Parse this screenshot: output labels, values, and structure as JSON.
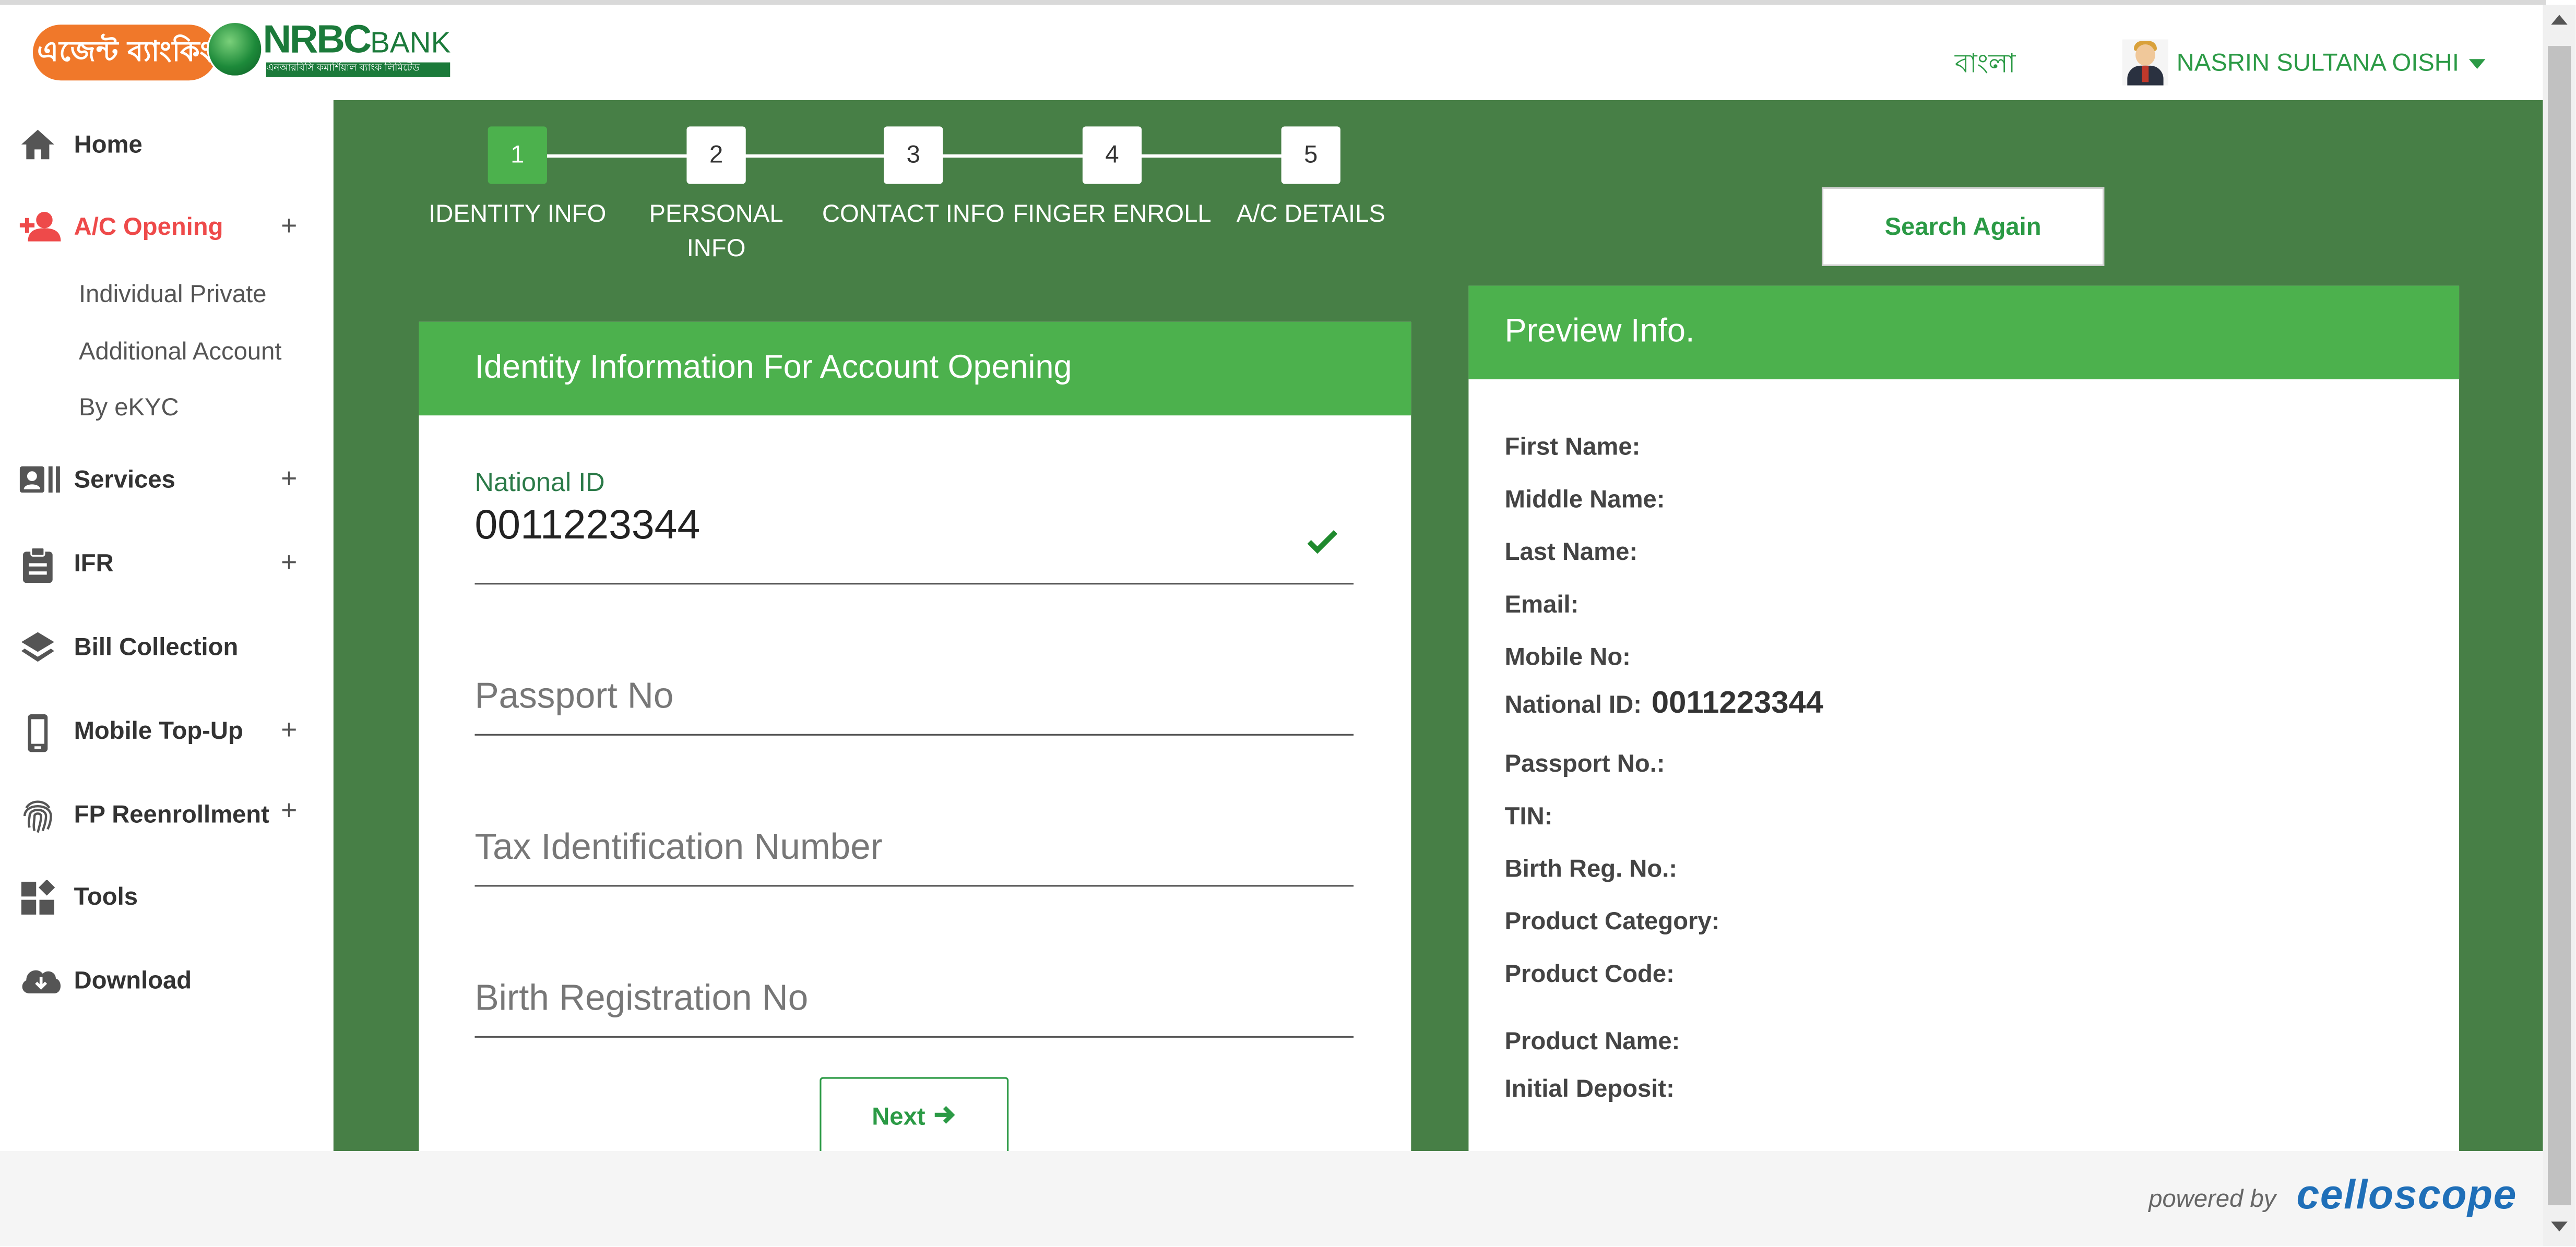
{
  "header": {
    "logo_agent_text": "এজেন্ট ব্যাংকিং",
    "logo_brand": "NRBC",
    "logo_bank": "BANK",
    "logo_tagline": "এনআরবিসি কমার্শিয়াল ব্যাংক লিমিটেড",
    "language": "বাংলা",
    "user_name": "NASRIN SULTANA OISHI"
  },
  "sidebar": {
    "items": [
      {
        "label": "Home",
        "icon": "home-icon",
        "expandable": false
      },
      {
        "label": "A/C Opening",
        "icon": "user-plus-icon",
        "expandable": true,
        "active": true,
        "children": [
          "Individual Private",
          "Additional Account",
          "By eKYC"
        ]
      },
      {
        "label": "Services",
        "icon": "id-card-icon",
        "expandable": true
      },
      {
        "label": "IFR",
        "icon": "clipboard-icon",
        "expandable": true
      },
      {
        "label": "Bill Collection",
        "icon": "layers-icon",
        "expandable": false
      },
      {
        "label": "Mobile Top-Up",
        "icon": "mobile-icon",
        "expandable": true
      },
      {
        "label": "FP Reenrollment",
        "icon": "fingerprint-icon",
        "expandable": true
      },
      {
        "label": "Tools",
        "icon": "widgets-icon",
        "expandable": false
      },
      {
        "label": "Download",
        "icon": "cloud-download-icon",
        "expandable": false
      }
    ],
    "expand_symbol": "+"
  },
  "stepper": {
    "current": 1,
    "steps": [
      {
        "num": "1",
        "label": "IDENTITY INFO"
      },
      {
        "num": "2",
        "label": "PERSONAL INFO"
      },
      {
        "num": "3",
        "label": "CONTACT INFO"
      },
      {
        "num": "4",
        "label": "FINGER ENROLL"
      },
      {
        "num": "5",
        "label": "A/C DETAILS"
      }
    ]
  },
  "actions": {
    "search_again": "Search Again",
    "next": "Next"
  },
  "identity_form": {
    "title": "Identity Information For Account Opening",
    "national_id_label": "National ID",
    "national_id_value": "0011223344",
    "passport_placeholder": "Passport No",
    "tin_placeholder": "Tax Identification Number",
    "birth_reg_placeholder": "Birth Registration No"
  },
  "preview": {
    "title": "Preview Info.",
    "fields": [
      {
        "label": "First Name:",
        "value": ""
      },
      {
        "label": "Middle Name:",
        "value": ""
      },
      {
        "label": "Last Name:",
        "value": ""
      },
      {
        "label": "Email:",
        "value": ""
      },
      {
        "label": "Mobile No:",
        "value": ""
      },
      {
        "label": "National ID:",
        "value": "0011223344"
      },
      {
        "label": "Passport No.:",
        "value": ""
      },
      {
        "label": "TIN:",
        "value": ""
      },
      {
        "label": "Birth Reg. No.:",
        "value": ""
      },
      {
        "label": "Product Category:",
        "value": ""
      },
      {
        "label": "Product Code:",
        "value": ""
      },
      {
        "label": "Product Name:",
        "value": ""
      },
      {
        "label": "Initial Deposit:",
        "value": ""
      }
    ]
  },
  "footer": {
    "powered_by": "powered by",
    "brand": "celloscope"
  },
  "colors": {
    "primary_green": "#4cb14d",
    "panel_green": "#477f46",
    "accent_red": "#ee4a4a",
    "brand_orange": "#f0782a",
    "link_green": "#2b9a45",
    "footer_brand_blue": "#1f6fb8"
  }
}
